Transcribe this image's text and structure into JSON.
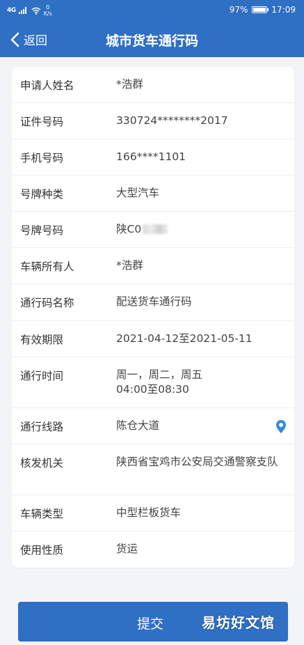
{
  "status_bar": {
    "signal": "4G",
    "net_speed_value": "0",
    "net_speed_unit": "K/s",
    "battery": "97%",
    "battery_level": 0.97,
    "time": "17:09"
  },
  "nav": {
    "back_label": "返回",
    "title": "城市货车通行码"
  },
  "rows": [
    {
      "label": "申请人姓名",
      "value": "*浩群"
    },
    {
      "label": "证件号码",
      "value": "330724********2017"
    },
    {
      "label": "手机号码",
      "value": "166****1101"
    },
    {
      "label": "号牌种类",
      "value": "大型汽车"
    },
    {
      "label": "号牌号码",
      "value": "陕C0"
    },
    {
      "label": "车辆所有人",
      "value": "*浩群"
    },
    {
      "label": "通行码名称",
      "value": "配送货车通行码"
    },
    {
      "label": "有效期限",
      "value": "2021-04-12至2021-05-11"
    },
    {
      "label": "通行时间",
      "value": "周一，周二，周五",
      "value2": "04:00至08:30"
    },
    {
      "label": "通行线路",
      "value": "陈仓大道"
    },
    {
      "label": "核发机关",
      "value": "陕西省宝鸡市公安局交通警察支队"
    },
    {
      "label": "车辆类型",
      "value": "中型栏板货车"
    },
    {
      "label": "使用性质",
      "value": "货运"
    }
  ],
  "submit_label": "提交",
  "watermark": "易坊好文馆",
  "colors": {
    "brand_blue": "#2f6fc4",
    "pin_blue": "#2d8cd8"
  },
  "icons": {
    "back": "chevron-left-icon",
    "route": "map-pin-icon",
    "wifi": "wifi-icon",
    "battery": "battery-icon"
  }
}
